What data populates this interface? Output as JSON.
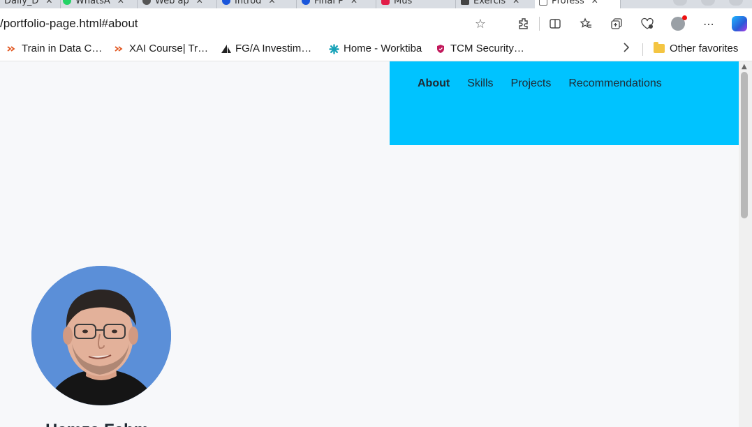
{
  "browser": {
    "tabs": [
      {
        "label": "Daily_D",
        "color": "#888888"
      },
      {
        "label": "WhatsA",
        "color": "#25d366"
      },
      {
        "label": "Web ap",
        "color": "#555555"
      },
      {
        "label": "Introd",
        "color": "#1a56db"
      },
      {
        "label": "Final P",
        "color": "#1a56db"
      },
      {
        "label": "Mus",
        "color": "#e11d48"
      },
      {
        "label": "Exercis",
        "color": "#444444"
      },
      {
        "label": "Profess",
        "color": "#666666"
      }
    ],
    "url": "/portfolio-page.html#about",
    "favorites": [
      {
        "label": "Train in Data C…",
        "color": "#e25822"
      },
      {
        "label": "XAI Course| Tr…",
        "color": "#e25822"
      },
      {
        "label": "FG/A Investim…",
        "color": "#222222"
      },
      {
        "label": "Home - Worktiba",
        "color": "#17a2b8"
      },
      {
        "label": "TCM Security…",
        "color": "#c2185b"
      }
    ],
    "other_favorites_label": "Other favorites"
  },
  "site": {
    "nav": {
      "items": [
        "About",
        "Skills",
        "Projects",
        "Recommendations"
      ],
      "active": "About",
      "bg_color": "#00c3ff"
    },
    "profile": {
      "photo_bg": "#5b8fd8",
      "name_partial": "Hamza Fahm"
    }
  }
}
